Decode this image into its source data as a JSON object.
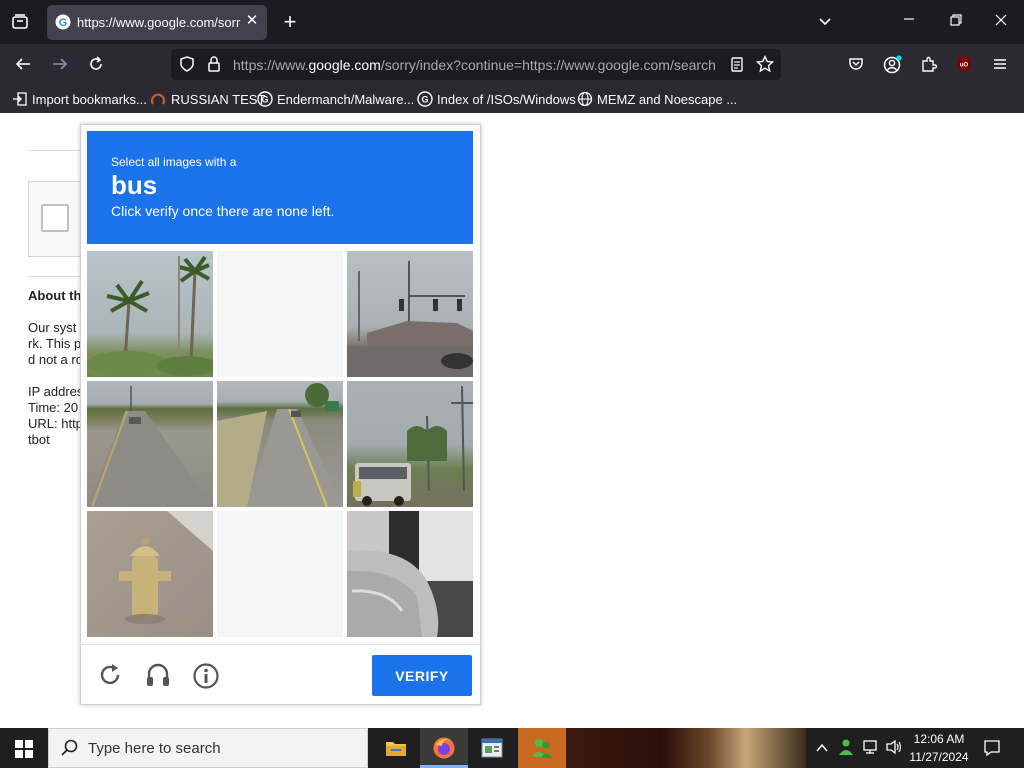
{
  "browser": {
    "tab_title": "https://www.google.com/sorr",
    "url_prefix": "https://www.",
    "url_domain": "google.com",
    "url_suffix": "/sorry/index?continue=https://www.google.com/search",
    "bookmarks": [
      {
        "label": "Import bookmarks...",
        "icon": "import-icon"
      },
      {
        "label": "RUSSIAN TEST",
        "icon": "page-icon"
      },
      {
        "label": "Endermanch/Malware...",
        "icon": "google-icon"
      },
      {
        "label": "Index of /ISOs/Windows",
        "icon": "google-icon"
      },
      {
        "label": "MEMZ and Noescape ...",
        "icon": "globe-icon"
      }
    ],
    "accent": "#1c1b22"
  },
  "background_page": {
    "about": "About th",
    "line1": "Our syst",
    "line2": "rk. This p",
    "line3": "d not a ro",
    "line4": "IP addres",
    "line5": "Time: 20",
    "line6": "URL: http",
    "line7": "tbot"
  },
  "captcha": {
    "instruction": "Select all images with a",
    "target": "bus",
    "subtext": "Click verify once there are none left.",
    "verify_label": "VERIFY",
    "header_color": "#1a73e8",
    "tiles": [
      {
        "content": "palm-trees",
        "state": "image"
      },
      {
        "content": "blank",
        "state": "loading"
      },
      {
        "content": "traffic-lights",
        "state": "image"
      },
      {
        "content": "road",
        "state": "image"
      },
      {
        "content": "road",
        "state": "image"
      },
      {
        "content": "bus",
        "state": "image"
      },
      {
        "content": "fire-hydrant",
        "state": "image"
      },
      {
        "content": "blank",
        "state": "loading"
      },
      {
        "content": "car",
        "state": "image"
      }
    ]
  },
  "taskbar": {
    "search_placeholder": "Type here to search",
    "time": "12:06 AM",
    "date": "11/27/2024"
  }
}
